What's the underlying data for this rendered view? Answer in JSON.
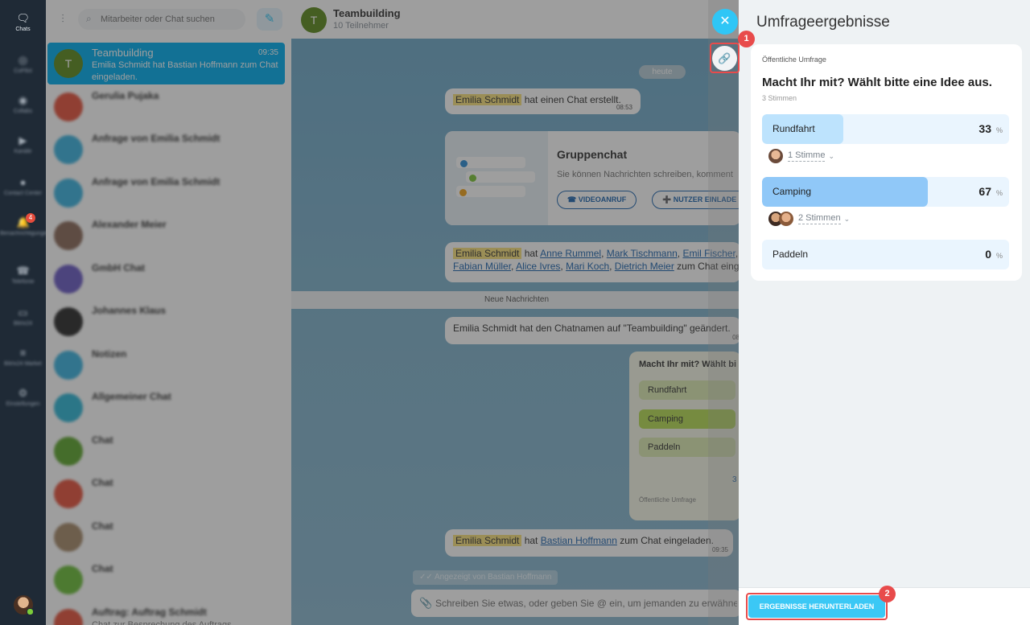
{
  "rail": {
    "items": [
      {
        "label": "Chats",
        "icon": "chat-bubbles-icon"
      },
      {
        "label": "CoPilot",
        "icon": "copilot-icon"
      },
      {
        "label": "Collabs",
        "icon": "collab-icon"
      },
      {
        "label": "Kanäle",
        "icon": "megaphone-icon"
      },
      {
        "label": "Contact Center",
        "icon": "contact-center-icon"
      },
      {
        "label": "Benachrichtigungen",
        "icon": "bell-icon"
      },
      {
        "label": "Telefonie",
        "icon": "phone-icon"
      },
      {
        "label": "Bitrix24",
        "icon": "monitor-icon"
      },
      {
        "label": "Bitrix24 Market",
        "icon": "market-icon"
      },
      {
        "label": "Einstellungen",
        "icon": "gear-icon"
      }
    ],
    "notification_badge": "4"
  },
  "search": {
    "placeholder": "Mitarbeiter oder Chat suchen"
  },
  "chat_list": [
    {
      "name": "Teambuilding",
      "time": "09:35",
      "preview": "Emilia Schmidt hat Bastian Hoffmann zum Chat eingeladen.",
      "avatar_letter": "T",
      "color": "#5e8b1e"
    },
    {
      "name": "Gerulia Pujaka",
      "time": "",
      "preview": "",
      "avatar_letter": "",
      "color": "#e5533d"
    },
    {
      "name": "Anfrage von Emilia Schmidt",
      "time": "",
      "preview": "",
      "avatar_letter": "",
      "color": "#3bb3e0"
    },
    {
      "name": "Anfrage von Emilia Schmidt",
      "time": "",
      "preview": "",
      "avatar_letter": "",
      "color": "#3bb3e0"
    },
    {
      "name": "Alexander Meier",
      "time": "",
      "preview": "",
      "avatar_letter": "",
      "color": "#8b6a5a"
    },
    {
      "name": "GmbH Chat",
      "time": "",
      "preview": "",
      "avatar_letter": "",
      "color": "#6b5bc4"
    },
    {
      "name": "Johannes Klaus",
      "time": "",
      "preview": "",
      "avatar_letter": "",
      "color": "#2b2b2b"
    },
    {
      "name": "Notizen",
      "time": "",
      "preview": "",
      "avatar_letter": "",
      "color": "#3bb3e0"
    },
    {
      "name": "Allgemeiner Chat",
      "time": "",
      "preview": "",
      "avatar_letter": "",
      "color": "#2fb6d6"
    },
    {
      "name": "Chat",
      "time": "",
      "preview": "",
      "avatar_letter": "",
      "color": "#5ea62e"
    },
    {
      "name": "Chat",
      "time": "",
      "preview": "",
      "avatar_letter": "",
      "color": "#e5533d"
    },
    {
      "name": "Chat",
      "time": "",
      "preview": "",
      "avatar_letter": "",
      "color": "#a68a6a"
    },
    {
      "name": "Chat",
      "time": "",
      "preview": "",
      "avatar_letter": "",
      "color": "#6cbe3a"
    },
    {
      "name": "Auftrag: Auftrag Schmidt",
      "time": "",
      "preview": "Chat zur Besprechung des Auftrags",
      "avatar_letter": "",
      "color": "#e5533d"
    }
  ],
  "chat": {
    "title": "Teambuilding",
    "subtitle": "10 Teilnehmer",
    "avatar_letter": "T",
    "day_label": "heute",
    "msg1": {
      "name": "Emilia Schmidt",
      "text": "hat einen Chat erstellt.",
      "time": "08:53"
    },
    "group_card": {
      "title": "Gruppenchat",
      "text": "Sie können Nachrichten schreiben, komment",
      "btn_video": "VIDEOANRUF",
      "btn_invite": "NUTZER EINLADE"
    },
    "msg2": {
      "name": "Emilia Schmidt",
      "text_a": "hat",
      "p1": "Anne Rummel",
      "p2": "Mark Tischmann",
      "p3": "Emil Fischer",
      "p4": "Fabian Müller",
      "p5": "Alice Ivres",
      "p6": "Mari Koch",
      "p7": "Dietrich Meier",
      "text_b": "zum Chat eing"
    },
    "new_messages": "Neue Nachrichten",
    "msg3": {
      "text": "Emilia Schmidt hat den Chatnamen auf \"Teambuilding\" geändert.",
      "time": "08"
    },
    "poll_bubble": {
      "question": "Macht Ihr mit? Wählt bi",
      "options": [
        "Rundfahrt",
        "Camping",
        "Paddeln"
      ],
      "count": "3",
      "type": "Öffentliche Umfrage"
    },
    "msg4": {
      "name": "Emilia Schmidt",
      "text_a": "hat",
      "person": "Bastian Hoffmann",
      "text_b": "zum Chat eingeladen.",
      "time": "09:35"
    },
    "viewed": "Angezeigt von Bastian Hoffmann",
    "input_placeholder": "Schreiben Sie etwas, oder geben Sie @ ein, um jemanden zu erwähne"
  },
  "panel": {
    "title": "Umfrageergebnisse",
    "poll_type": "Öffentliche Umfrage",
    "question": "Macht Ihr mit? Wählt bitte eine Idee aus.",
    "votes_total": "3 Stimmen",
    "options": [
      {
        "label": "Rundfahrt",
        "percent": 33,
        "percent_text": "33",
        "voters_text": "1 Stimme"
      },
      {
        "label": "Camping",
        "percent": 67,
        "percent_text": "67",
        "voters_text": "2 Stimmen"
      },
      {
        "label": "Paddeln",
        "percent": 0,
        "percent_text": "0",
        "voters_text": ""
      }
    ],
    "percent_sign": "%",
    "download_button": "ERGEBNISSE HERUNTERLADEN",
    "marker_1": "1",
    "marker_2": "2",
    "colors": {
      "accent": "#2fc6f6",
      "bar_light": "#bde3fd",
      "bar_strong": "#90c8f8",
      "highlight": "#e84b4b"
    }
  }
}
